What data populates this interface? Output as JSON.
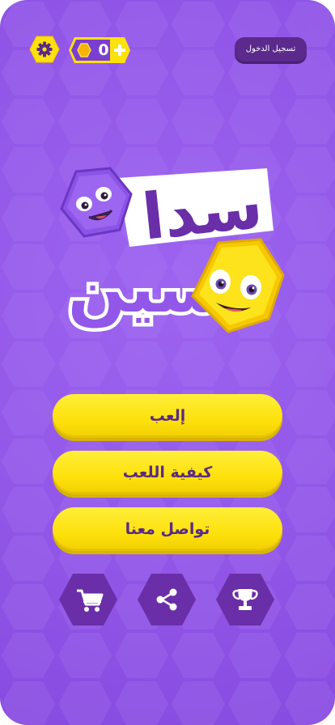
{
  "header": {
    "settings_icon": "gear-icon",
    "coins": {
      "count": "0",
      "coin_icon": "coin-icon",
      "add_icon": "plus-icon"
    },
    "login_label": "تسجيل الدخول"
  },
  "logo": {
    "text_line_1": "سدا",
    "text_line_2": "سين"
  },
  "menu": {
    "play_label": "إلعب",
    "how_to_play_label": "كيفية اللعب",
    "contact_label": "تواصل معنا"
  },
  "bottom_actions": [
    {
      "icon": "cart-icon"
    },
    {
      "icon": "share-icon"
    },
    {
      "icon": "trophy-icon"
    }
  ],
  "colors": {
    "background": "#9257e8",
    "button_yellow": "#fde10c",
    "button_text": "#5a2a86",
    "dark_purple": "#5b2a8c",
    "hex_dark": "#6a2ea8"
  }
}
